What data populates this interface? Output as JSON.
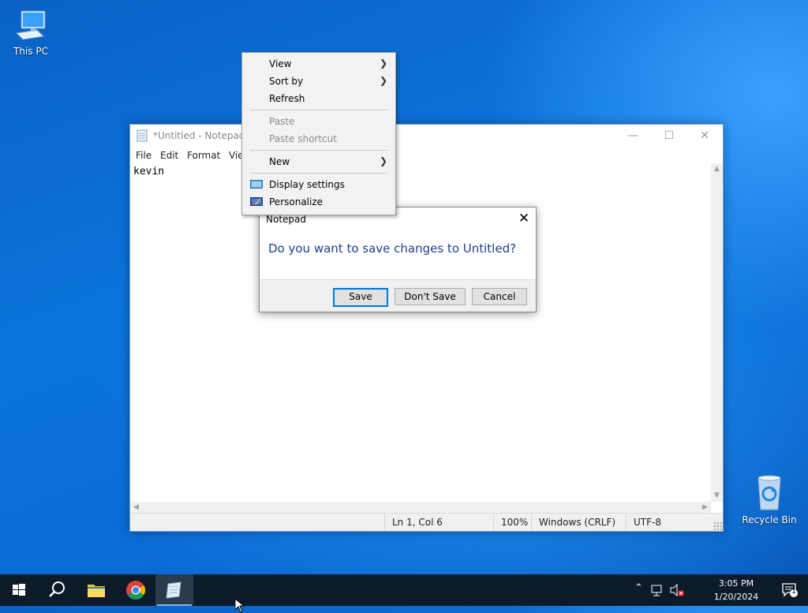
{
  "desktop": {
    "icons": [
      {
        "label": "This PC",
        "icon": "computer-icon"
      },
      {
        "label": "Recycle Bin",
        "icon": "recycle-bin-icon"
      }
    ]
  },
  "notepad": {
    "title": "*Untitled - Notepad",
    "menu": [
      "File",
      "Edit",
      "Format",
      "Vie"
    ],
    "content": "kevin",
    "status": {
      "position": "Ln 1, Col 6",
      "zoom": "100%",
      "line_ending": "Windows (CRLF)",
      "encoding": "UTF-8"
    }
  },
  "dialog": {
    "title": "Notepad",
    "message": "Do you want to save changes to Untitled?",
    "buttons": {
      "save": "Save",
      "dont_save": "Don't Save",
      "cancel": "Cancel"
    }
  },
  "context_menu": {
    "items": [
      {
        "label": "View",
        "submenu": true,
        "enabled": true
      },
      {
        "label": "Sort by",
        "submenu": true,
        "enabled": true
      },
      {
        "label": "Refresh",
        "submenu": false,
        "enabled": true
      },
      {
        "label": "Paste",
        "submenu": false,
        "enabled": false
      },
      {
        "label": "Paste shortcut",
        "submenu": false,
        "enabled": false
      },
      {
        "label": "New",
        "submenu": true,
        "enabled": true
      },
      {
        "label": "Display settings",
        "submenu": false,
        "enabled": true,
        "icon": "display-icon"
      },
      {
        "label": "Personalize",
        "submenu": false,
        "enabled": true,
        "icon": "personalize-icon"
      }
    ]
  },
  "taskbar": {
    "apps": [
      "start-icon",
      "search-icon",
      "file-explorer-icon",
      "chrome-icon",
      "notepad-icon"
    ],
    "clock": {
      "time": "3:05 PM",
      "date": "1/20/2024"
    },
    "notification_count": "1"
  },
  "colors": {
    "accent": "#0078d7",
    "dialog_text": "#1e3f8a"
  }
}
